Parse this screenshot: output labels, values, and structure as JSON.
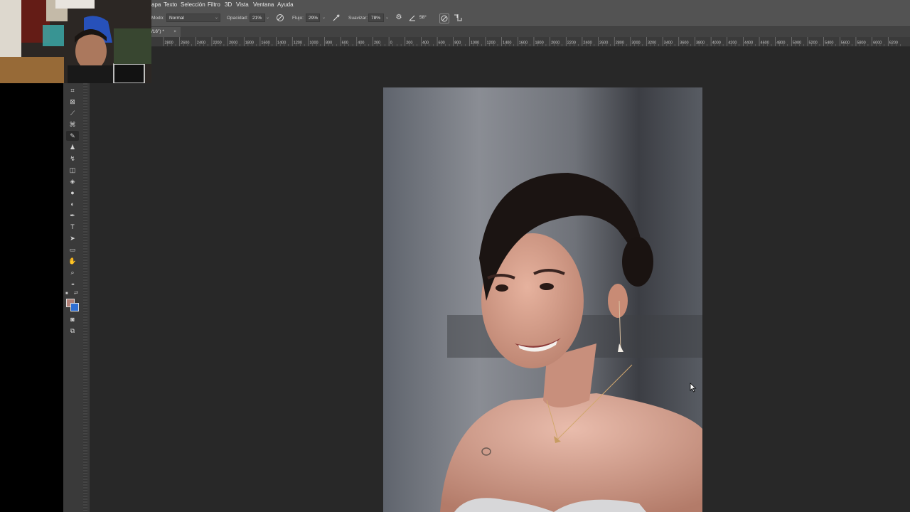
{
  "menubar": {
    "items": [
      "apa",
      "Texto",
      "Selección",
      "Filtro",
      "3D",
      "Vista",
      "Ventana",
      "Ayuda"
    ]
  },
  "options": {
    "mode_label": "Modo:",
    "mode_value": "Normal",
    "opacity_label": "Opacidad:",
    "opacity_value": "21%",
    "flow_label": "Flujo:",
    "flow_value": "29%",
    "smoothing_label": "Suavizar:",
    "smoothing_value": "78%",
    "angle_value": "58°"
  },
  "document": {
    "tab_title": "/16\") *",
    "close_symbol": "×"
  },
  "ruler": {
    "labels": [
      "2800",
      "2600",
      "2400",
      "2200",
      "2000",
      "1800",
      "1600",
      "1400",
      "1200",
      "1000",
      "800",
      "600",
      "400",
      "200",
      "0",
      "200",
      "400",
      "600",
      "800",
      "1000",
      "1200",
      "1400",
      "1600",
      "1800",
      "2000",
      "2200",
      "2400",
      "2600",
      "2800",
      "3000",
      "3200",
      "3400",
      "3600",
      "3800",
      "4000",
      "4200",
      "4400",
      "4600",
      "4800",
      "5000",
      "5200",
      "5400",
      "5600",
      "5800",
      "6000",
      "6200"
    ]
  },
  "toolbar": {
    "tools": [
      {
        "name": "crop-tool",
        "icon": "crop-icon",
        "glyph": "⌗"
      },
      {
        "name": "frame-tool",
        "icon": "frame-icon",
        "glyph": "⊠"
      },
      {
        "name": "eyedropper-tool",
        "icon": "eyedropper-icon",
        "glyph": "⟋"
      },
      {
        "name": "healing-tool",
        "icon": "healing-brush-icon",
        "glyph": "⌘"
      },
      {
        "name": "brush-tool",
        "icon": "brush-icon",
        "glyph": "✎"
      },
      {
        "name": "stamp-tool",
        "icon": "clone-stamp-icon",
        "glyph": "♟"
      },
      {
        "name": "history-brush-tool",
        "icon": "history-brush-icon",
        "glyph": "↯"
      },
      {
        "name": "eraser-tool",
        "icon": "eraser-icon",
        "glyph": "◫"
      },
      {
        "name": "paint-bucket-tool",
        "icon": "paint-bucket-icon",
        "glyph": "◈"
      },
      {
        "name": "blur-tool",
        "icon": "blur-drop-icon",
        "glyph": "●"
      },
      {
        "name": "dodge-tool",
        "icon": "dodge-icon",
        "glyph": "◐"
      },
      {
        "name": "pen-tool",
        "icon": "pen-icon",
        "glyph": "✒"
      },
      {
        "name": "type-tool",
        "icon": "type-icon",
        "glyph": "T"
      },
      {
        "name": "path-selection-tool",
        "icon": "arrow-select-icon",
        "glyph": "➤"
      },
      {
        "name": "rectangle-tool",
        "icon": "rectangle-icon",
        "glyph": "▭"
      },
      {
        "name": "hand-tool",
        "icon": "hand-icon",
        "glyph": "✋"
      },
      {
        "name": "zoom-tool",
        "icon": "zoom-icon",
        "glyph": "⌕"
      },
      {
        "name": "more-tools",
        "icon": "ellipsis-icon",
        "glyph": "•••"
      }
    ],
    "bottom": [
      {
        "name": "quick-mask-button",
        "icon": "quick-mask-icon",
        "glyph": "◙"
      },
      {
        "name": "screen-mode-button",
        "icon": "screen-mode-icon",
        "glyph": "⧉"
      }
    ]
  },
  "colors": {
    "foreground": "#b07f76",
    "background": "#2f6fd3"
  }
}
